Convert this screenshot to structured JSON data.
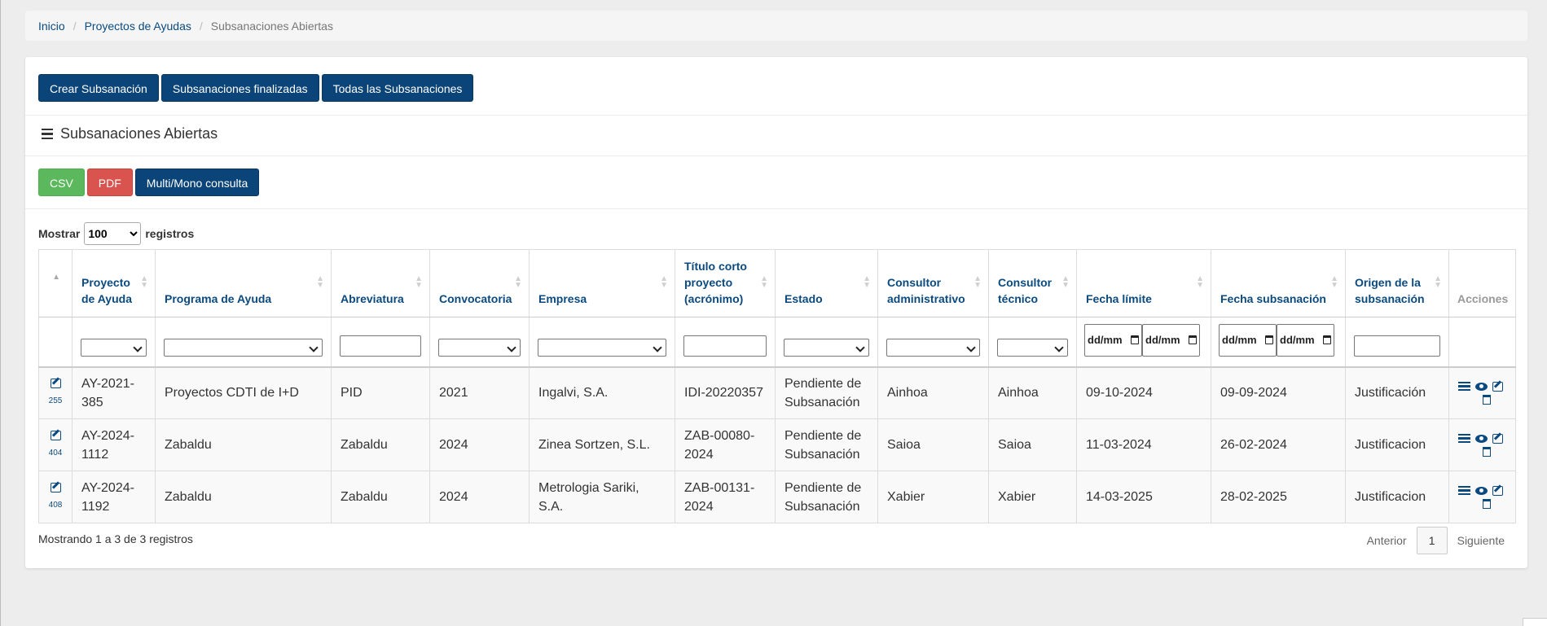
{
  "breadcrumb": {
    "home": "Inicio",
    "projects": "Proyectos de Ayudas",
    "current": "Subsanaciones Abiertas",
    "separator": "/"
  },
  "toolbar": {
    "create_label": "Crear Subsanación",
    "finished_label": "Subsanaciones finalizadas",
    "all_label": "Todas las Subsanaciones"
  },
  "section": {
    "title": "Subsanaciones Abiertas"
  },
  "exports": {
    "csv": "CSV",
    "pdf": "PDF",
    "multi": "Multi/Mono consulta"
  },
  "length": {
    "before": "Mostrar",
    "value": "100",
    "after": "registros"
  },
  "table": {
    "headers": {
      "proyecto": "Proyecto de Ayuda",
      "programa": "Programa de Ayuda",
      "abreviatura": "Abreviatura",
      "convocatoria": "Convocatoria",
      "empresa": "Empresa",
      "titulo": "Título corto proyecto (acrónimo)",
      "estado": "Estado",
      "cons_admin": "Consultor administrativo",
      "cons_tec": "Consultor técnico",
      "fecha_limite": "Fecha límite",
      "fecha_subsanacion": "Fecha subsanación",
      "origen": "Origen de la subsanación",
      "acciones": "Acciones"
    },
    "date_placeholder": "dd/mm",
    "rows": [
      {
        "id": "255",
        "proyecto": "AY-2021-385",
        "programa": "Proyectos CDTI de I+D",
        "abreviatura": "PID",
        "convocatoria": "2021",
        "empresa": "Ingalvi, S.A.",
        "titulo": "IDI-20220357",
        "estado": "Pendiente de Subsanación",
        "cons_admin": "Ainhoa",
        "cons_tec": "Ainhoa",
        "fecha_limite": "09-10-2024",
        "fecha_subsanacion": "09-09-2024",
        "origen": "Justificación"
      },
      {
        "id": "404",
        "proyecto": "AY-2024-1112",
        "programa": "Zabaldu",
        "abreviatura": "Zabaldu",
        "convocatoria": "2024",
        "empresa": "Zinea Sortzen, S.L.",
        "titulo": "ZAB-00080-2024",
        "estado": "Pendiente de Subsanación",
        "cons_admin": "Saioa",
        "cons_tec": "Saioa",
        "fecha_limite": "11-03-2024",
        "fecha_subsanacion": "26-02-2024",
        "origen": "Justificacion"
      },
      {
        "id": "408",
        "proyecto": "AY-2024-1192",
        "programa": "Zabaldu",
        "abreviatura": "Zabaldu",
        "convocatoria": "2024",
        "empresa": "Metrologia Sariki, S.A.",
        "titulo": "ZAB-00131-2024",
        "estado": "Pendiente de Subsanación",
        "cons_admin": "Xabier",
        "cons_tec": "Xabier",
        "fecha_limite": "14-03-2025",
        "fecha_subsanacion": "28-02-2025",
        "origen": "Justificacion"
      }
    ]
  },
  "footer": {
    "info": "Mostrando 1 a 3 de 3 registros",
    "prev": "Anterior",
    "page": "1",
    "next": "Siguiente"
  },
  "colors": {
    "primary": "#0b4478",
    "success": "#5cb85c",
    "danger": "#d9534f",
    "link": "#0b4a7f"
  }
}
